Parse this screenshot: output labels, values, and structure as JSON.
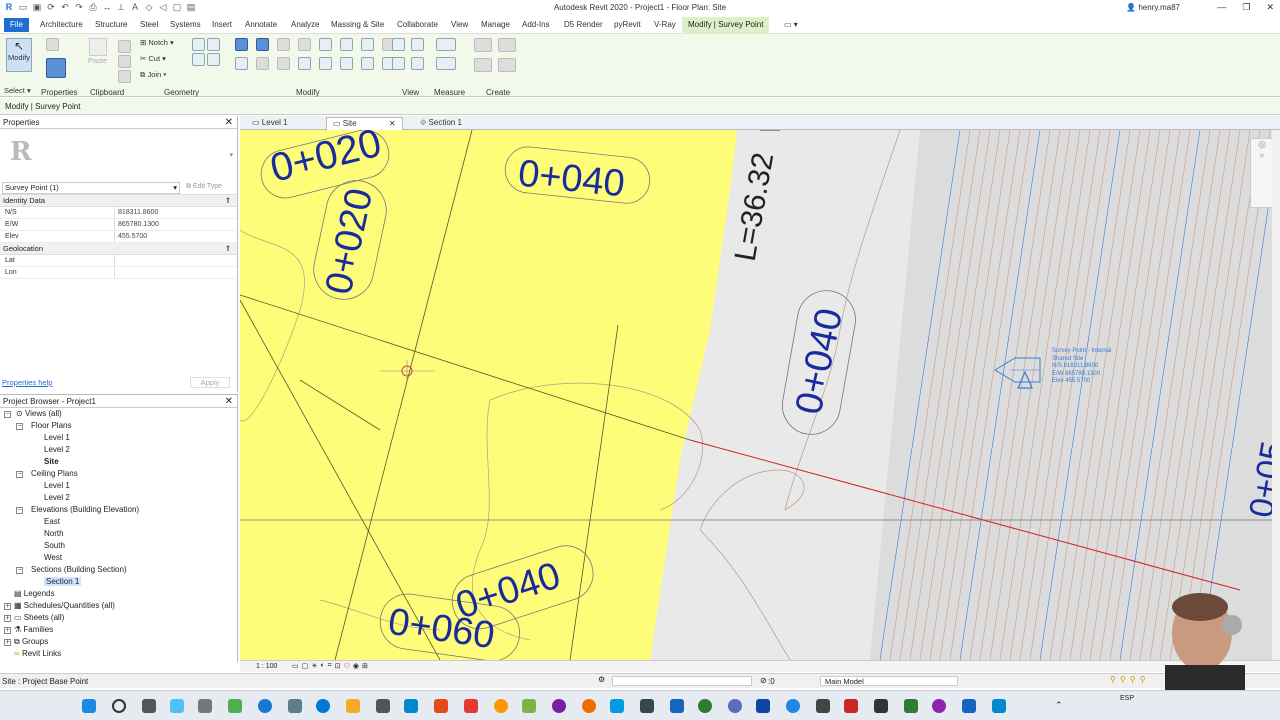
{
  "titlebar": {
    "title": "Autodesk Revit 2020 - Project1 - Floor Plan: Site",
    "user": "henry.ma87"
  },
  "ribbon_tabs": [
    "File",
    "Architecture",
    "Structure",
    "Steel",
    "Systems",
    "Insert",
    "Annotate",
    "Analyze",
    "Massing & Site",
    "Collaborate",
    "View",
    "Manage",
    "Add-Ins",
    "D5 Render",
    "pyRevit",
    "V-Ray",
    "Modify | Survey Point"
  ],
  "ribbon": {
    "modify_label": "Modify",
    "select_label": "Select",
    "properties_label": "Properties",
    "paste_label": "Paste",
    "clipboard_label": "Clipboard",
    "notch_label": "Notch",
    "cut_label": "Cut",
    "join_label": "Join",
    "geometry_label": "Geometry",
    "modify_panel_label": "Modify",
    "view_label": "View",
    "measure_label": "Measure",
    "create_label": "Create"
  },
  "context_bar": {
    "label": "Modify | Survey Point"
  },
  "properties": {
    "title": "Properties",
    "type_selector": "Survey Point (1)",
    "edit_type": "Edit Type",
    "groups": [
      {
        "name": "Identity Data",
        "rows": [
          {
            "key": "N/S",
            "value": "818311.8600"
          },
          {
            "key": "E/W",
            "value": "865780.1300"
          },
          {
            "key": "Elev",
            "value": "455.5700"
          }
        ]
      },
      {
        "name": "Geolocation",
        "rows": [
          {
            "key": "Lat",
            "value": ""
          },
          {
            "key": "Lon",
            "value": ""
          }
        ]
      }
    ],
    "help_link": "Properties help",
    "apply_button": "Apply"
  },
  "browser": {
    "title": "Project Browser - Project1",
    "items": {
      "views": "Views (all)",
      "floor_plans": "Floor Plans",
      "fp_level1": "Level 1",
      "fp_level2": "Level 2",
      "fp_site": "Site",
      "ceiling_plans": "Ceiling Plans",
      "cp_level1": "Level 1",
      "cp_level2": "Level 2",
      "elevations": "Elevations (Building Elevation)",
      "east": "East",
      "north": "North",
      "south": "South",
      "west": "West",
      "sections": "Sections (Building Section)",
      "section1": "Section 1",
      "legends": "Legends",
      "schedules": "Schedules/Quantities (all)",
      "sheets": "Sheets (all)",
      "families": "Families",
      "groups": "Groups",
      "revit_links": "Revit Links"
    }
  },
  "view_tabs": [
    "Level 1",
    "Site",
    "Section 1"
  ],
  "canvas": {
    "labels": {
      "st_020_top": "0+020",
      "st_040_top": "0+040",
      "st_020_vert": "0+020",
      "st_040_right": "0+040",
      "st_040_bottom": "0+040",
      "st_060_bottom": "0+060",
      "curve_label": "L=36.32",
      "edge_label": "0+05"
    },
    "survey_point_tag": {
      "title": "Survey Point - Internal",
      "shared": "Shared Site",
      "ns": "N/S   818311.8600",
      "ew": "E/W   865780.1300",
      "elev": "Elev   455.5700"
    }
  },
  "view_control_bar": {
    "scale": "1 : 100"
  },
  "status_bar": {
    "text": "Site : Project Base Point",
    "zero": ":0",
    "model": "Main Model"
  },
  "colors": {
    "yellow_fill": "#fdfd7a",
    "label_blue": "#1a2b9c",
    "ribbon_green": "#f3f9ea",
    "red_line": "#d22222",
    "hatch_blue": "#3a7bd5"
  },
  "taskbar": {
    "lang": "ESP"
  }
}
